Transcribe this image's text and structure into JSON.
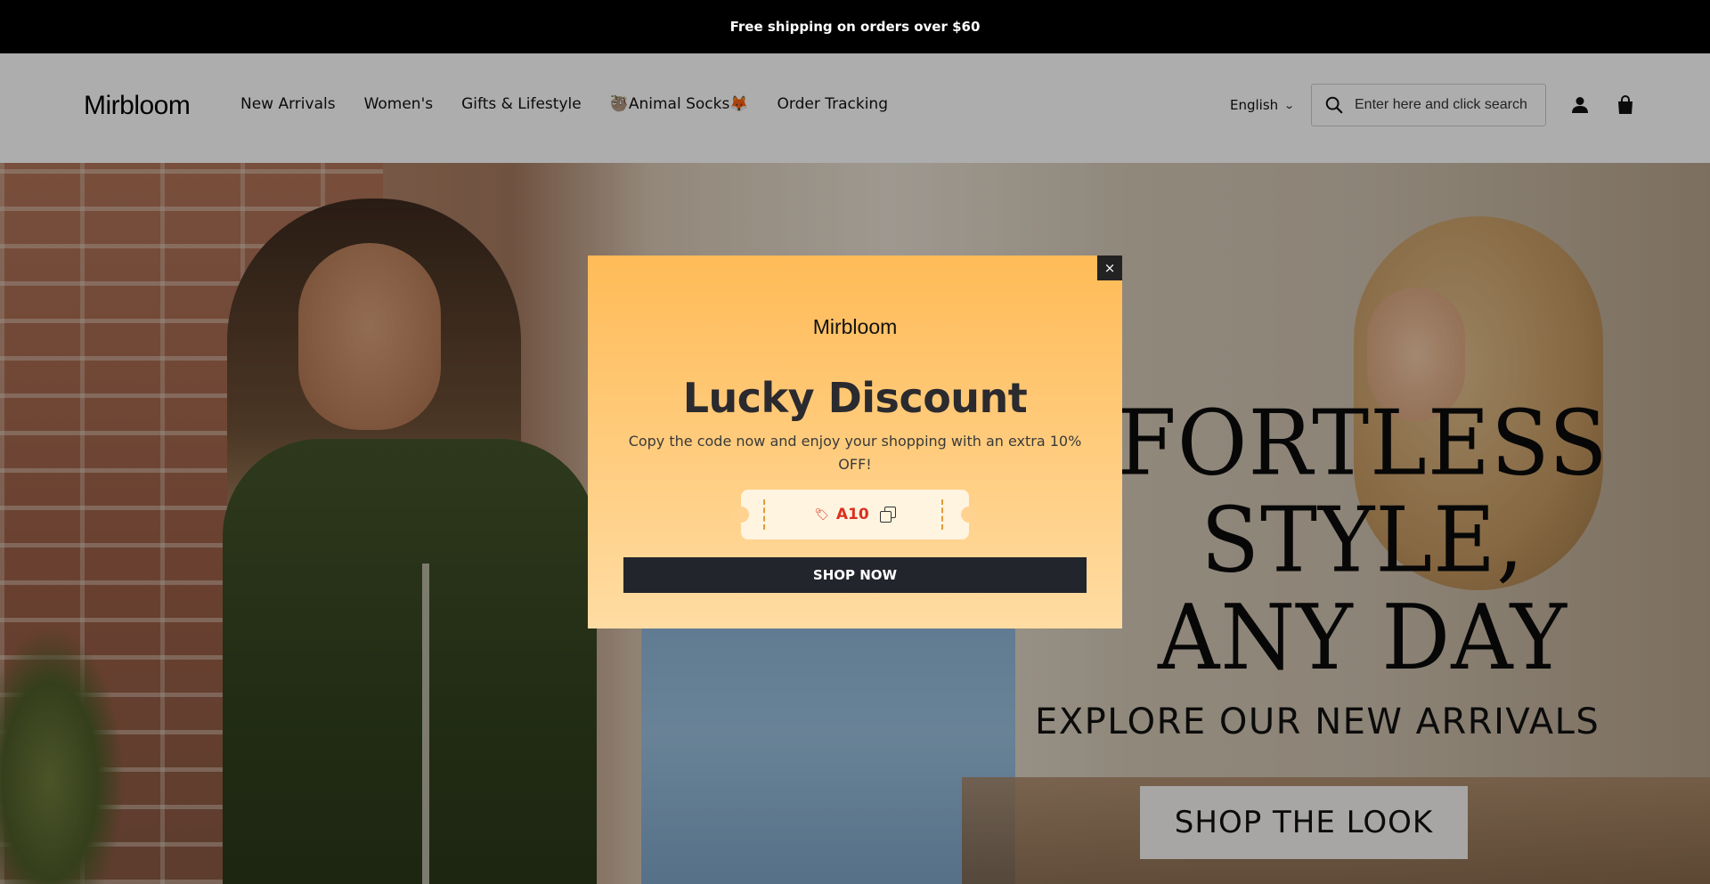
{
  "announcement": {
    "text": "Free shipping on orders over $60"
  },
  "header": {
    "logo": "Mirbloom",
    "nav": [
      {
        "label": "New Arrivals"
      },
      {
        "label": "Women's"
      },
      {
        "label": "Gifts & Lifestyle"
      },
      {
        "label": "🦥Animal Socks🦊"
      },
      {
        "label": "Order Tracking"
      }
    ],
    "language": "English",
    "search": {
      "placeholder": "Enter here and click search",
      "value": ""
    },
    "icons": [
      "search-icon",
      "account-icon",
      "cart-icon",
      "chevron-down-icon"
    ]
  },
  "hero": {
    "headline": [
      "FORTLESS",
      "STYLE,",
      "ANY DAY"
    ],
    "subheadline": "EXPLORE OUR NEW ARRIVALS",
    "cta": "SHOP THE LOOK"
  },
  "popup": {
    "close_label": "×",
    "logo": "Mirbloom",
    "title": "Lucky Discount",
    "description": "Copy the code now and enjoy your shopping with an extra 10% OFF!",
    "coupon_code": "A10",
    "button_label": "SHOP NOW",
    "colors": {
      "gradient_top": "#ffbb57",
      "gradient_bottom": "#ffdca3",
      "code": "#d9321f",
      "button": "#22252c"
    }
  }
}
